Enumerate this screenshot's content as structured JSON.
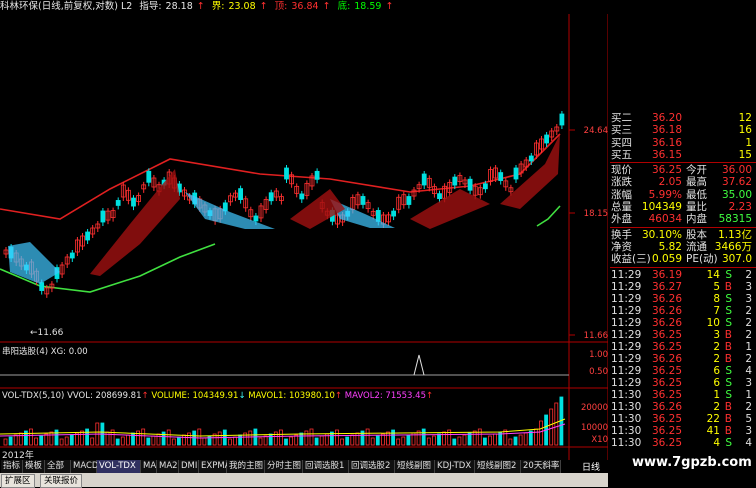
{
  "header": {
    "title": "科林环保(日线,前复权,对数) L2",
    "zhidao_label": "指导:",
    "zhidao_value": "28.18",
    "jie_label": "界:",
    "jie_value": "23.08",
    "ding_label": "顶:",
    "ding_value": "36.84",
    "di_label": "底:",
    "di_value": "18.59"
  },
  "price_axis": [
    "24.64",
    "18.15",
    "11.66"
  ],
  "annotations": {
    "low_marker": "←11.66"
  },
  "indicator_panel": {
    "title": "串阳选股(4)",
    "xg_label": "XG:",
    "xg_value": "0.00",
    "axis": [
      "1.00",
      "0.50"
    ]
  },
  "volume_panel": {
    "title": "VOL-TDX(5,10)",
    "vvol": "VVOL: 208699.81",
    "volume": "VOLUME: 104349.91",
    "mavol1": "MAVOL1: 103980.10",
    "mavol2": "MAVOL2: 71553.45",
    "axis": [
      "20000",
      "10000",
      "X10"
    ]
  },
  "date_label": "2012年",
  "tabs": [
    "指标",
    "模板",
    "全部",
    "MACD",
    "VOL-TDX",
    "MA",
    "MA2",
    "DMI",
    "EXPMA",
    "我的主图",
    "分时主图",
    "回调选股1",
    "回调选股2",
    "短线副图",
    "KDJ-TDX",
    "短线副图2",
    "20天斜率"
  ],
  "bottom_buttons": [
    "扩展区",
    "关联报价"
  ],
  "right_controls": {
    "period": "日线",
    "plus": "+",
    "minus": "-"
  },
  "quote": {
    "bids": [
      {
        "label": "买二",
        "price": "36.20",
        "vol": "12"
      },
      {
        "label": "买三",
        "price": "36.18",
        "vol": "16"
      },
      {
        "label": "买四",
        "price": "36.16",
        "vol": "1"
      },
      {
        "label": "买五",
        "price": "36.15",
        "vol": "15"
      }
    ],
    "stats": [
      {
        "l1": "现价",
        "v1": "36.25",
        "l2": "今开",
        "v2": "36.00"
      },
      {
        "l1": "涨跌",
        "v1": "2.05",
        "l2": "最高",
        "v2": "37.62"
      },
      {
        "l1": "涨幅",
        "v1": "5.99%",
        "l2": "最低",
        "v2": "35.00"
      },
      {
        "l1": "总量",
        "v1": "104349",
        "l2": "量比",
        "v2": "2.23"
      },
      {
        "l1": "外盘",
        "v1": "46034",
        "l2": "内盘",
        "v2": "58315"
      }
    ],
    "stats2": [
      {
        "l1": "换手",
        "v1": "30.10%",
        "l2": "股本",
        "v2": "1.13亿"
      },
      {
        "l1": "净资",
        "v1": "5.82",
        "l2": "流通",
        "v2": "3466万"
      },
      {
        "l1": "收益(三)",
        "v1": "0.059",
        "l2": "PE(动)",
        "v2": "307.0"
      }
    ],
    "ticks": [
      {
        "t": "11:29",
        "p": "36.19",
        "v": "14",
        "s": "S",
        "n": "2"
      },
      {
        "t": "11:29",
        "p": "36.27",
        "v": "5",
        "s": "B",
        "n": "3"
      },
      {
        "t": "11:29",
        "p": "36.26",
        "v": "8",
        "s": "S",
        "n": "3"
      },
      {
        "t": "11:29",
        "p": "36.26",
        "v": "7",
        "s": "S",
        "n": "2"
      },
      {
        "t": "11:29",
        "p": "36.26",
        "v": "10",
        "s": "S",
        "n": "2"
      },
      {
        "t": "11:29",
        "p": "36.25",
        "v": "3",
        "s": "B",
        "n": "2"
      },
      {
        "t": "11:29",
        "p": "36.25",
        "v": "2",
        "s": "B",
        "n": "1"
      },
      {
        "t": "11:29",
        "p": "36.26",
        "v": "2",
        "s": "B",
        "n": "2"
      },
      {
        "t": "11:29",
        "p": "36.25",
        "v": "6",
        "s": "S",
        "n": "4"
      },
      {
        "t": "11:29",
        "p": "36.25",
        "v": "6",
        "s": "S",
        "n": "3"
      },
      {
        "t": "11:30",
        "p": "36.25",
        "v": "1",
        "s": "S",
        "n": "1"
      },
      {
        "t": "11:30",
        "p": "36.26",
        "v": "2",
        "s": "B",
        "n": "2"
      },
      {
        "t": "11:30",
        "p": "36.25",
        "v": "22",
        "s": "B",
        "n": "5"
      },
      {
        "t": "11:30",
        "p": "36.25",
        "v": "41",
        "s": "B",
        "n": "3"
      },
      {
        "t": "11:30",
        "p": "36.25",
        "v": "4",
        "s": "S",
        "n": "4"
      }
    ]
  },
  "watermark": "www.7gpzb.com",
  "colors": {
    "up": "#ff3030",
    "down": "#40e0ff",
    "ma_red": "#e02020",
    "ma_green": "#40e040",
    "grid": "#b00000"
  }
}
